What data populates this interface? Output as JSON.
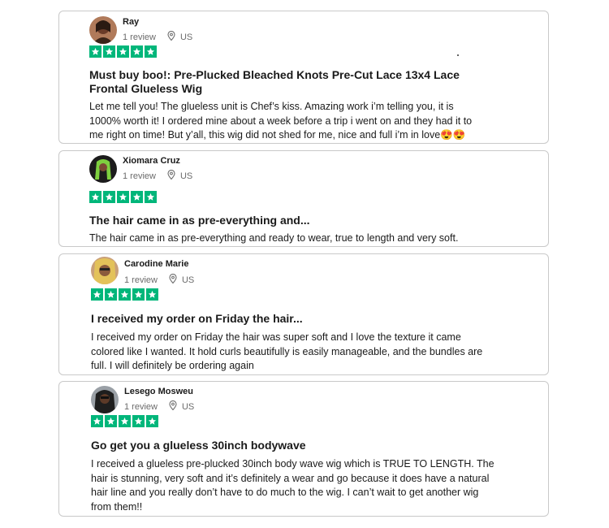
{
  "reviews": [
    {
      "name": "Ray",
      "review_count": "1 review",
      "country": "US",
      "rating": 5,
      "title": "Must buy boo!: Pre-Plucked Bleached Knots Pre-Cut Lace 13x4 Lace Frontal Glueless Wig",
      "body": "Let me tell you! The glueless unit is Chef’s kiss. Amazing work i’m telling you, it is 1000% worth it! I ordered mine about a week before a trip i went on and they had it to me right on time! But y’all, this wig did not shed for me, nice and full i’m in love😍😍"
    },
    {
      "name": "Xiomara Cruz",
      "review_count": "1 review",
      "country": "US",
      "rating": 5,
      "title": "The hair came in as pre-everything and...",
      "body": "The hair came in as pre-everything and ready to wear, true to length and very soft."
    },
    {
      "name": "Carodine Marie",
      "review_count": "1 review",
      "country": "US",
      "rating": 5,
      "title": "I received my order on Friday the hair...",
      "body": "I received my order on Friday the hair was super soft and I love the texture it came colored like I wanted. It hold curls beautifully is easily manageable, and the bundles are full. I will definitely be ordering again"
    },
    {
      "name": "Lesego Mosweu",
      "review_count": "1 review",
      "country": "US",
      "rating": 5,
      "title": "Go get you a glueless 30inch bodywave",
      "body": "I received a glueless pre-plucked 30inch body wave wig which is TRUE TO LENGTH. The hair is stunning, very soft and it’s definitely a wear and go because it does have a natural hair line and you really don’t have to do much to the wig. I can’t wait to get another wig from them!!"
    }
  ],
  "colors": {
    "star_green": "#00b67a",
    "border": "#c9c9c9",
    "meta_gray": "#6b6b6b"
  },
  "icons": {
    "location": "location-pin-icon",
    "star": "star-icon"
  }
}
